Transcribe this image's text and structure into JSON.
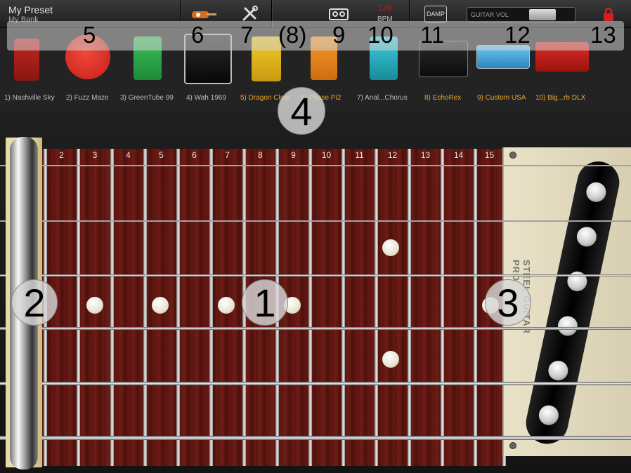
{
  "preset": {
    "name": "My Preset",
    "bank": "My Bank"
  },
  "topbar": {
    "bpm_value": "120",
    "bpm_label": "BPM",
    "damp_label": "DAMP",
    "guitar_vol_label": "GUITAR VOL"
  },
  "callouts": {
    "n1": "1",
    "n2": "2",
    "n3": "3",
    "n4": "4",
    "n5": "5",
    "n6": "6",
    "n7": "7",
    "n8": "(8)",
    "n9": "9",
    "n10": "10",
    "n11": "11",
    "n12": "12",
    "n13": "13"
  },
  "pedals": [
    {
      "label": "1) Nashville Sky",
      "color": "#b3211d",
      "active": false
    },
    {
      "label": "2) Fuzz Maze",
      "color": "#e2332a",
      "active": false
    },
    {
      "label": "3) GreenTube 99",
      "color": "#2ea84a",
      "active": false
    },
    {
      "label": "4) Wah 1969",
      "color": "#111111",
      "active": false
    },
    {
      "label": "5) Dragon Claw",
      "color": "#e8c21a",
      "active": true
    },
    {
      "label": "6) Phase Pi2",
      "color": "#f08a1c",
      "active": true
    },
    {
      "label": "7) Anal...Chorus",
      "color": "#2ab8c8",
      "active": false
    },
    {
      "label": "8) EchoRex",
      "color": "#1a1a1a",
      "active": true
    },
    {
      "label": "9) Custom USA",
      "color": "#3aa4d8",
      "active": true
    },
    {
      "label": "10) Big...rb DLX",
      "color": "#c0201a",
      "active": true
    }
  ],
  "fret_numbers": [
    "2",
    "3",
    "4",
    "5",
    "6",
    "7",
    "8",
    "9",
    "10",
    "11",
    "12",
    "13",
    "14",
    "15"
  ],
  "plate_text": "STEEL GUITAR PRO",
  "colors": {
    "accent_gold": "#e3a530",
    "bpm_red": "#dd1111",
    "fretboard": "#5a1410"
  }
}
